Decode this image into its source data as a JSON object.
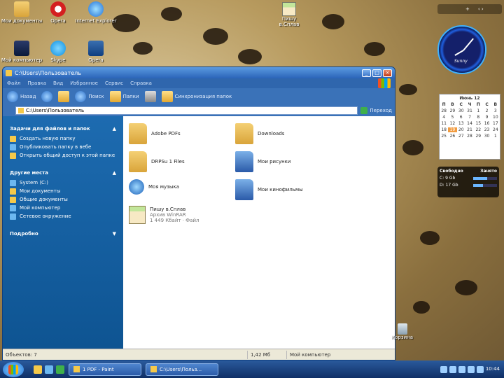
{
  "desktop": {
    "icons": [
      {
        "label": "Мои документы"
      },
      {
        "label": "Opera"
      },
      {
        "label": "Internet Explorer"
      },
      {
        "label": "Мой компьютер"
      },
      {
        "label": "Skype"
      },
      {
        "label": "Opera"
      }
    ],
    "float_icon": {
      "label": "Пишу в.Сплав"
    },
    "trash": {
      "label": "Корзина"
    }
  },
  "window": {
    "title": "C:\\Users\\Пользователь",
    "menu": [
      "Файл",
      "Правка",
      "Вид",
      "Избранное",
      "Сервис",
      "Справка"
    ],
    "toolbar": {
      "back": "Назад",
      "search": "Поиск",
      "folders": "Папки",
      "sync": "Синхронизация папок"
    },
    "address": {
      "label": "",
      "value": "C:\\Users\\Пользователь",
      "go": "Переход"
    },
    "sidebar": {
      "tasks_title": "Задачи для файлов и папок",
      "tasks": [
        "Создать новую папку",
        "Опубликовать папку в вебе",
        "Открыть общий доступ к этой папке"
      ],
      "places_title": "Другие места",
      "places": [
        "System (C:)",
        "Мои документы",
        "Общие документы",
        "Мой компьютер",
        "Сетевое окружение"
      ],
      "details_title": "Подробно"
    },
    "items": [
      {
        "name": "Adobe PDFs"
      },
      {
        "name": "Downloads"
      },
      {
        "name": "DRPSu 1 Files"
      },
      {
        "name": "Мои рисунки"
      },
      {
        "name": "Моя музыка"
      },
      {
        "name": "Мои кинофильмы"
      },
      {
        "name": "Пишу в.Сплав",
        "meta1": "Архив WinRAR",
        "meta2": "1 449 Кбайт · Файл"
      }
    ],
    "status": {
      "objects": "Объектов: 7",
      "size": "1,42 Мб",
      "location": "Мой компьютер"
    }
  },
  "gadgets": {
    "top_bar": {
      "plus": "+",
      "arrows": "‹ ›"
    },
    "clock_label": "Sunny",
    "calendar": {
      "month": "Июнь 12",
      "weekdays": [
        "П",
        "В",
        "С",
        "Ч",
        "П",
        "С",
        "В"
      ],
      "days": [
        "28",
        "29",
        "30",
        "31",
        "1",
        "2",
        "3",
        "4",
        "5",
        "6",
        "7",
        "8",
        "9",
        "10",
        "11",
        "12",
        "13",
        "14",
        "15",
        "16",
        "17",
        "18",
        "19",
        "20",
        "21",
        "22",
        "23",
        "24",
        "25",
        "26",
        "27",
        "28",
        "29",
        "30",
        "1"
      ],
      "today": "19"
    },
    "drives": {
      "head_free": "Свободно",
      "head_used": "Занято",
      "rows": [
        {
          "name": "C: 9 Gb",
          "used_fraction": 0.6
        },
        {
          "name": "D: 17 Gb",
          "used_fraction": 0.4
        }
      ]
    }
  },
  "taskbar": {
    "tasks": [
      "1 PDF - Paint",
      "C:\\Users\\Польз..."
    ],
    "clock": "10:44"
  }
}
